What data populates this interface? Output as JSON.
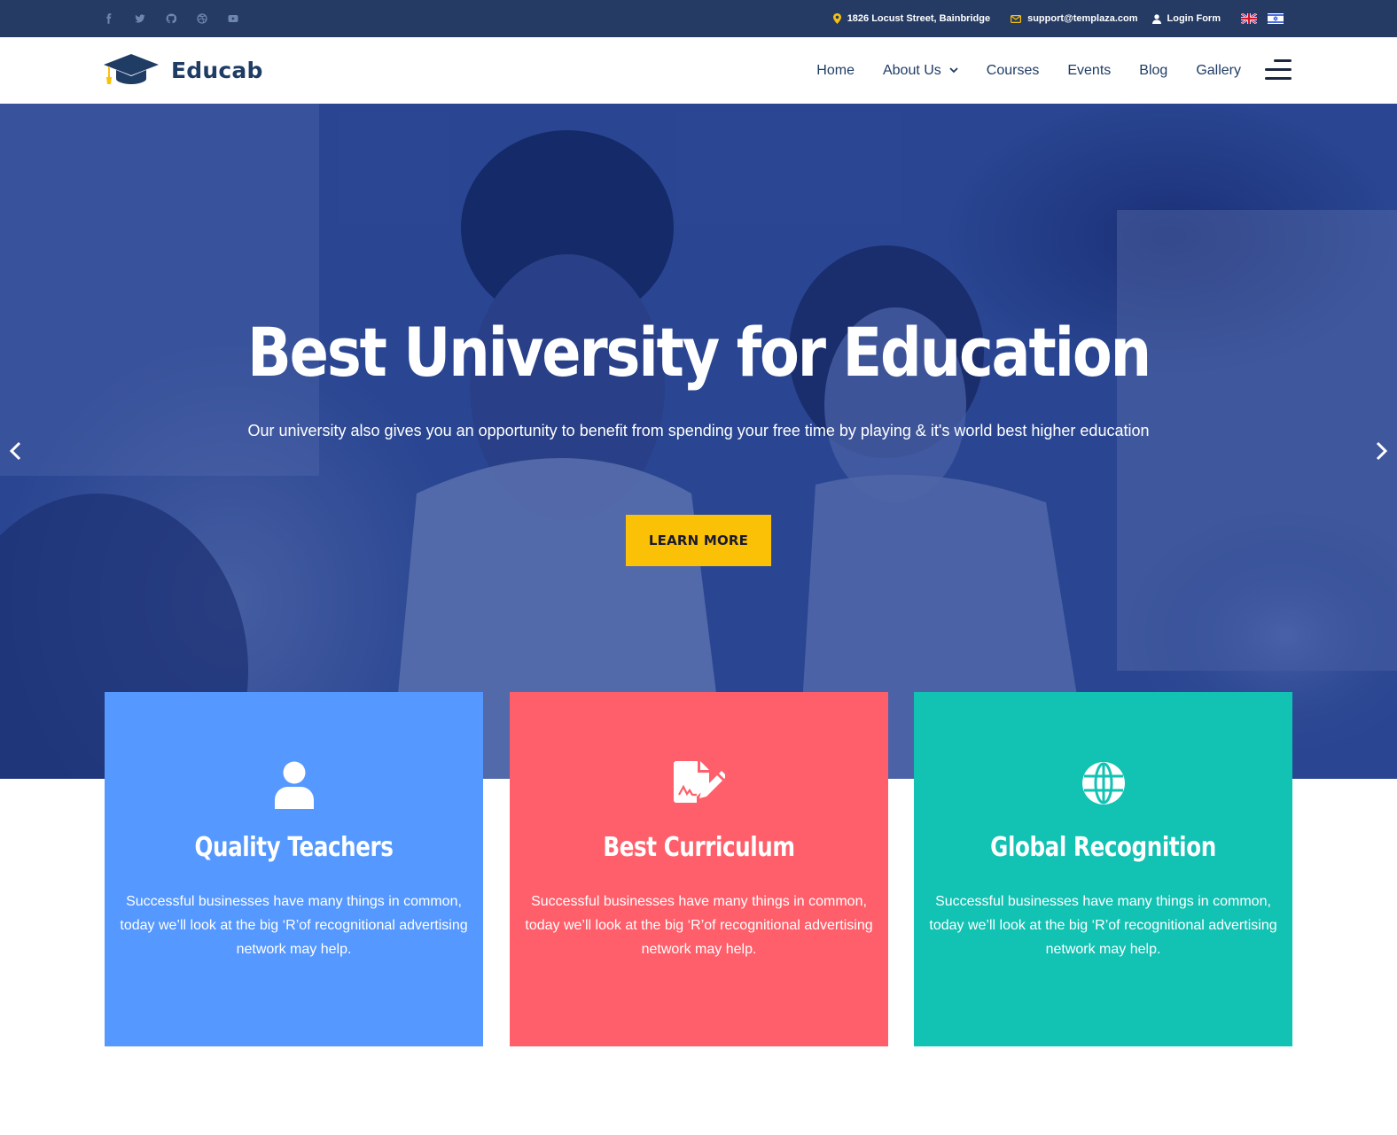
{
  "topbar": {
    "social": [
      {
        "icon": "facebook-icon"
      },
      {
        "icon": "twitter-icon"
      },
      {
        "icon": "github-icon"
      },
      {
        "icon": "dribbble-icon"
      },
      {
        "icon": "youtube-icon"
      }
    ],
    "address": "1826 Locust Street, Bainbridge",
    "email": "support@templaza.com",
    "login": "Login Form",
    "languages": [
      "english-flag-icon",
      "israel-flag-icon"
    ]
  },
  "header": {
    "logo_text": "Educab",
    "nav": [
      "Home",
      "About Us",
      "Courses",
      "Events",
      "Blog",
      "Gallery"
    ]
  },
  "hero": {
    "title": "Best University for Education",
    "subtitle": "Our university also gives you an opportunity to benefit from spending your free time by playing & it's world best higher education",
    "button": "LEARN MORE"
  },
  "features": [
    {
      "icon": "user-icon",
      "title": "Quality Teachers",
      "text": "Successful businesses have many things in common, today we’ll look at the big ‘R’of recognitional advertising network may help.",
      "color": "#5598ff"
    },
    {
      "icon": "file-signature-icon",
      "title": "Best Curriculum",
      "text": "Successful businesses have many things in common, today we’ll look at the big ‘R’of recognitional advertising network may help.",
      "color": "#ff5f6a"
    },
    {
      "icon": "globe-icon",
      "title": "Global Recognition",
      "text": "Successful businesses have many things in common, today we’ll look at the big ‘R’of recognitional advertising network may help.",
      "color": "#12c2b3"
    }
  ],
  "colors": {
    "topbar": "#253b64",
    "brand": "#1f3c64",
    "accent": "#fbc106"
  }
}
